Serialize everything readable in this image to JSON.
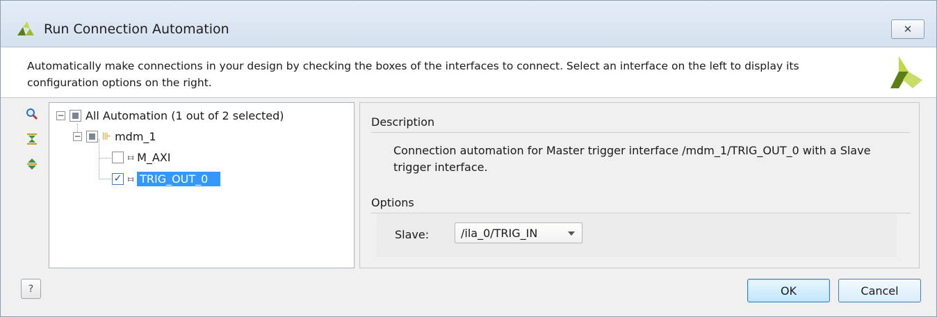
{
  "window": {
    "title": "Run Connection Automation",
    "close_glyph": "✕"
  },
  "header": {
    "message": "Automatically make connections in your design by checking the boxes of the interfaces to connect. Select an interface on the left to display its configuration options on the right."
  },
  "toolbar": {
    "icons": [
      "search-icon",
      "collapse-all-icon",
      "expand-all-icon"
    ]
  },
  "tree": {
    "root": {
      "label": "All Automation (1 out of 2 selected)",
      "state": "partial",
      "expanded": true
    },
    "component": {
      "label": "mdm_1",
      "state": "partial",
      "expanded": true
    },
    "interfaces": [
      {
        "label": "M_AXI",
        "checked": false,
        "selected": false
      },
      {
        "label": "TRIG_OUT_0",
        "checked": true,
        "selected": true
      }
    ]
  },
  "details": {
    "description_heading": "Description",
    "description_text": "Connection automation for Master trigger interface /mdm_1/TRIG_OUT_0 with a Slave trigger interface.",
    "options_heading": "Options",
    "slave_label": "Slave:",
    "slave_value": "/ila_0/TRIG_IN"
  },
  "buttons": {
    "help": "?",
    "ok": "OK",
    "cancel": "Cancel"
  },
  "colors": {
    "selection": "#3399ff",
    "accent_logo": "#9dbb2c",
    "logo_dark": "#5b7f12"
  }
}
